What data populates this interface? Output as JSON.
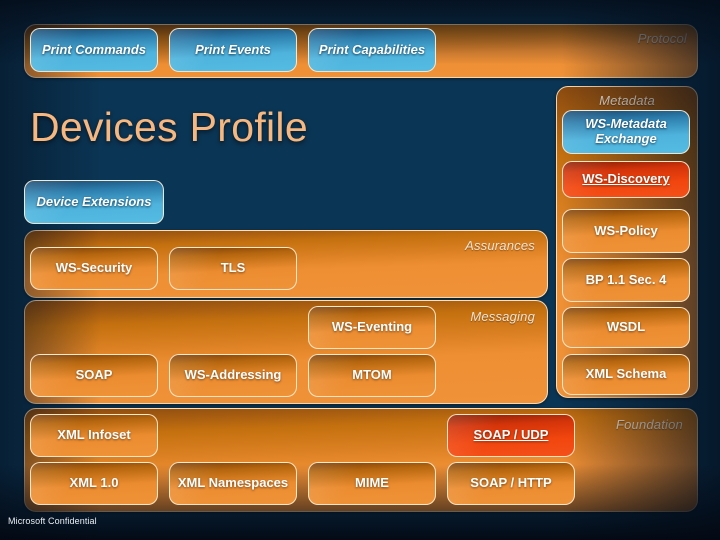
{
  "slide": {
    "title": "Devices Profile",
    "footer": "Microsoft Confidential"
  },
  "colors": {
    "background_deep": "#071f35",
    "background_mid": "#175d92",
    "panel_orange": "#ef8f34",
    "chip_orange": "#ec8c30",
    "chip_blue": "#4fb4dd",
    "chip_red": "#f2460e",
    "title_text": "#f7b77e",
    "label_text": "#f2e3d2"
  },
  "layers": [
    {
      "id": "protocol",
      "label": "Protocol",
      "boxes": [
        {
          "label": "Print Commands",
          "style": "blue"
        },
        {
          "label": "Print Events",
          "style": "blue"
        },
        {
          "label": "Print Capabilities",
          "style": "blue"
        }
      ]
    },
    {
      "id": "assurances",
      "label": "Assurances",
      "boxes": [
        {
          "label": "WS-Security",
          "style": "orange"
        },
        {
          "label": "TLS",
          "style": "orange"
        }
      ]
    },
    {
      "id": "messaging",
      "label": "Messaging",
      "boxes": [
        {
          "label": "WS-Eventing",
          "style": "orange"
        },
        {
          "label": "SOAP",
          "style": "orange"
        },
        {
          "label": "WS-Addressing",
          "style": "orange"
        },
        {
          "label": "MTOM",
          "style": "orange"
        }
      ]
    },
    {
      "id": "foundation",
      "label": "Foundation",
      "boxes": [
        {
          "label": "XML Infoset",
          "style": "orange"
        },
        {
          "label": "SOAP / UDP",
          "style": "red"
        },
        {
          "label": "XML 1.0",
          "style": "orange"
        },
        {
          "label": "XML Namespaces",
          "style": "orange"
        },
        {
          "label": "MIME",
          "style": "orange"
        },
        {
          "label": "SOAP / HTTP",
          "style": "orange"
        }
      ]
    },
    {
      "id": "metadata",
      "label": "Metadata",
      "boxes": [
        {
          "label": "WS-Metadata Exchange",
          "style": "blue"
        },
        {
          "label": "WS-Discovery",
          "style": "red"
        },
        {
          "label": "WS-Policy",
          "style": "orange"
        },
        {
          "label": "BP 1.1 Sec. 4",
          "style": "orange"
        },
        {
          "label": "WSDL",
          "style": "orange"
        },
        {
          "label": "XML Schema",
          "style": "orange"
        }
      ]
    }
  ],
  "standalone": {
    "device_extensions": "Device Extensions"
  }
}
